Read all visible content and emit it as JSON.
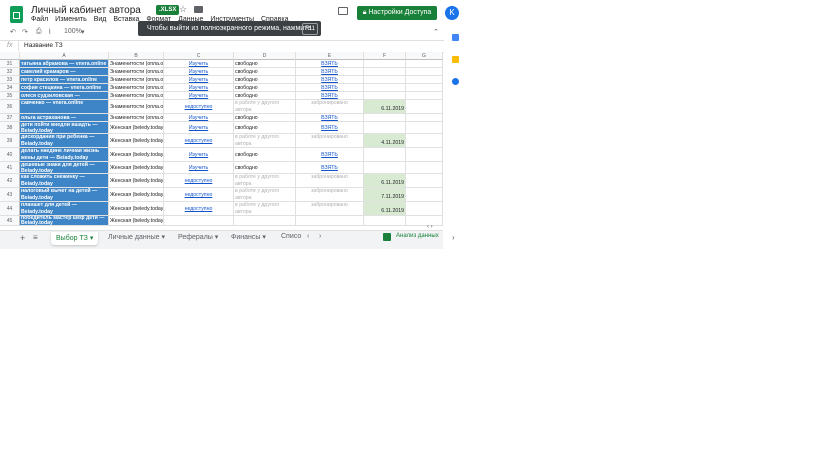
{
  "header": {
    "title": "Личный кабинет автора",
    "badge": ".XLSX",
    "share_label": "Настройки Доступа",
    "avatar_letter": "K",
    "menu": [
      "Файл",
      "Изменить",
      "Вид",
      "Вставка",
      "Формат",
      "Данные",
      "Инструменты",
      "Справка"
    ]
  },
  "banner": {
    "text": "Чтобы выйти из полноэкранного режима, нажмите",
    "key": "F11"
  },
  "toolbar": {
    "zoom": "100%"
  },
  "formula_bar": {
    "fx": "fx",
    "value": "Название ТЗ"
  },
  "columns": [
    "A",
    "B",
    "C",
    "D",
    "E",
    "F",
    "G"
  ],
  "rows": [
    {
      "num": "31",
      "a": "татьяна абрамова — vnera.online",
      "b": "Знаменитости (опла.о",
      "c": "Изучить",
      "d": "свободно",
      "e": "ВЗЯТЬ",
      "f": "",
      "d_gray": false,
      "e_gray": false
    },
    {
      "num": "32",
      "a": "савелий крамаров — vnera.online",
      "b": "Знаменитости (опла.о",
      "c": "Изучить",
      "d": "свободно",
      "e": "ВЗЯТЬ",
      "f": "",
      "d_gray": false,
      "e_gray": false
    },
    {
      "num": "33",
      "a": "петр красилов — vnera.online",
      "b": "Знаменитости (опла.о",
      "c": "Изучить",
      "d": "свободно",
      "e": "ВЗЯТЬ",
      "f": "",
      "d_gray": false,
      "e_gray": false
    },
    {
      "num": "34",
      "a": "софия стецкина — vnera.online",
      "b": "Знаменитости (опла.о",
      "c": "Изучить",
      "d": "свободно",
      "e": "ВЗЯТЬ",
      "f": "",
      "d_gray": false,
      "e_gray": false
    },
    {
      "num": "35",
      "a": "олеся судзиловская — vnera.online",
      "b": "Знаменитости (опла.о",
      "c": "Изучить",
      "d": "свободно",
      "e": "ВЗЯТЬ",
      "f": "",
      "d_gray": false,
      "e_gray": false
    },
    {
      "num": "36",
      "a": "савченко — vnera.online",
      "b": "Знаменитости (опла.о",
      "c": "недоступно",
      "d": "в работе у другого автора",
      "e": "забронировано",
      "f": "6.11.2019",
      "d_gray": true,
      "e_gray": true
    },
    {
      "num": "37",
      "a": "ольга астраханова — vnera.online",
      "b": "Знаменитости (опла.о",
      "c": "Изучить",
      "d": "свободно",
      "e": "ВЗЯТЬ",
      "f": "",
      "d_gray": false,
      "e_gray": false
    },
    {
      "num": "38",
      "a": "дети пойти внедли вшадть — Beiady.today",
      "b": "Женская (beledy.today)",
      "c": "Изучить",
      "d": "свободно",
      "e": "ВЗЯТЬ",
      "f": "",
      "d_gray": false,
      "e_gray": false
    },
    {
      "num": "39",
      "a": "дискордания при ребенка — Beiady.today",
      "b": "Женская (beledy.today)",
      "c": "недоступно",
      "d": "в работе у другого автора",
      "e": "забронировано",
      "f": "4.11.2019",
      "d_gray": true,
      "e_gray": true
    },
    {
      "num": "40",
      "a": "делать наедине личная жизнь жены дети — Beiady.today",
      "b": "Женская (beledy.today)",
      "c": "Изучить",
      "d": "свободно",
      "e": "ВЗЯТЬ",
      "f": "",
      "d_gray": false,
      "e_gray": false
    },
    {
      "num": "41",
      "a": "дешевые знаки для детей — Beiady.today",
      "b": "Женская (beledy.today)",
      "c": "Изучить",
      "d": "свободно",
      "e": "ВЗЯТЬ",
      "f": "",
      "d_gray": false,
      "e_gray": false
    },
    {
      "num": "42",
      "a": "как сложить снежинку — Beiady.today",
      "b": "Женская (beledy.today)",
      "c": "недоступно",
      "d": "в работе у другого автора",
      "e": "забронировано",
      "f": "6.11.2019",
      "d_gray": true,
      "e_gray": true
    },
    {
      "num": "43",
      "a": "налоговый вычет на детей — Beiady.today",
      "b": "Женская (beledy.today)",
      "c": "недоступно",
      "d": "в работе у другого автора",
      "e": "забронировано",
      "f": "7.11.2019",
      "d_gray": true,
      "e_gray": true
    },
    {
      "num": "44",
      "a": "планшет для детей — Beiady.today",
      "b": "Женская (beledy.today)",
      "c": "недоступно",
      "d": "в работе у другого автора",
      "e": "забронировано",
      "f": "6.11.2019",
      "d_gray": true,
      "e_gray": true
    },
    {
      "num": "45",
      "a": "победитель мастер шеф дети — Beiady.today",
      "b": "Женская (beledy.today)",
      "c": "",
      "d": "",
      "e": "",
      "f": "",
      "d_gray": false,
      "e_gray": false
    }
  ],
  "tabs": [
    "Выбор ТЗ",
    "Личные данные",
    "Рефералы",
    "Финансы",
    "Списо"
  ],
  "explore_label": "Анализ данных"
}
